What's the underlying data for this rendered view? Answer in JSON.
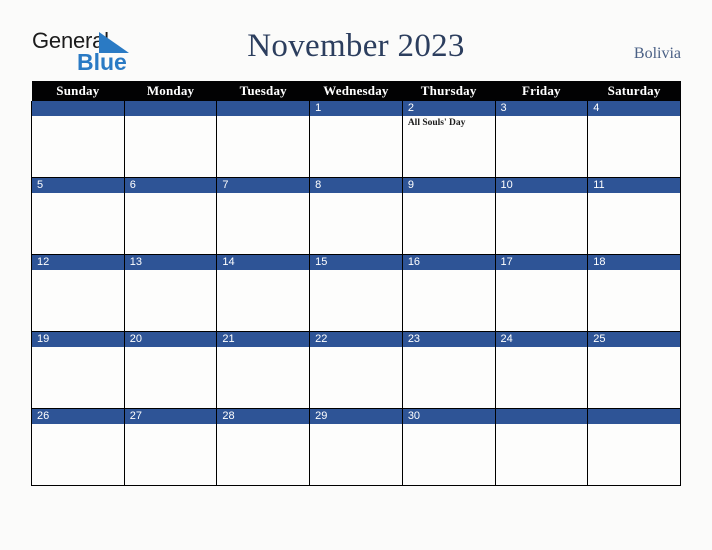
{
  "logo": {
    "word_top": "General",
    "word_bottom": "Blue",
    "triangle_icon": "blue-triangle-icon",
    "color_top": "#1b1b1b",
    "color_bottom": "#2a7ac4"
  },
  "header": {
    "title": "November 2023",
    "country": "Bolivia",
    "title_color": "#2c3e5e",
    "country_color": "#4a6085"
  },
  "calendar": {
    "accent_blue": "#2e5496",
    "header_bg": "#020203",
    "cell_bg": "#fdfdfc",
    "page_bg": "#fbfbfa",
    "weekday_headers": [
      "Sunday",
      "Monday",
      "Tuesday",
      "Wednesday",
      "Thursday",
      "Friday",
      "Saturday"
    ],
    "weeks": [
      [
        {
          "day": "",
          "event": ""
        },
        {
          "day": "",
          "event": ""
        },
        {
          "day": "",
          "event": ""
        },
        {
          "day": "1",
          "event": ""
        },
        {
          "day": "2",
          "event": "All Souls' Day"
        },
        {
          "day": "3",
          "event": ""
        },
        {
          "day": "4",
          "event": ""
        }
      ],
      [
        {
          "day": "5",
          "event": ""
        },
        {
          "day": "6",
          "event": ""
        },
        {
          "day": "7",
          "event": ""
        },
        {
          "day": "8",
          "event": ""
        },
        {
          "day": "9",
          "event": ""
        },
        {
          "day": "10",
          "event": ""
        },
        {
          "day": "11",
          "event": ""
        }
      ],
      [
        {
          "day": "12",
          "event": ""
        },
        {
          "day": "13",
          "event": ""
        },
        {
          "day": "14",
          "event": ""
        },
        {
          "day": "15",
          "event": ""
        },
        {
          "day": "16",
          "event": ""
        },
        {
          "day": "17",
          "event": ""
        },
        {
          "day": "18",
          "event": ""
        }
      ],
      [
        {
          "day": "19",
          "event": ""
        },
        {
          "day": "20",
          "event": ""
        },
        {
          "day": "21",
          "event": ""
        },
        {
          "day": "22",
          "event": ""
        },
        {
          "day": "23",
          "event": ""
        },
        {
          "day": "24",
          "event": ""
        },
        {
          "day": "25",
          "event": ""
        }
      ],
      [
        {
          "day": "26",
          "event": ""
        },
        {
          "day": "27",
          "event": ""
        },
        {
          "day": "28",
          "event": ""
        },
        {
          "day": "29",
          "event": ""
        },
        {
          "day": "30",
          "event": ""
        },
        {
          "day": "",
          "event": ""
        },
        {
          "day": "",
          "event": ""
        }
      ]
    ]
  }
}
